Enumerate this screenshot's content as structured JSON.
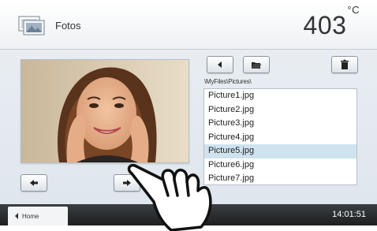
{
  "header": {
    "title": "Fotos",
    "temperature": "403",
    "unit": "°C"
  },
  "viewer": {
    "photo_alt": "Portrait photo"
  },
  "filebrowser": {
    "path": "\\MyFiles\\Pictures\\",
    "files": [
      "Picture1.jpg",
      "Picture2.jpg",
      "Picture3.jpg",
      "Picture4.jpg",
      "Picture5.jpg",
      "Picture6.jpg",
      "Picture7.jpg"
    ],
    "selected_index": 4
  },
  "footer": {
    "home_label": "Home",
    "time": "14:01:51"
  },
  "colors": {
    "selected_row": "#cfe3ef",
    "footer": "#2b2e31"
  },
  "icons": {
    "app": "photos-icon",
    "back": "arrow-left-icon",
    "open": "folder-icon",
    "delete": "trash-icon",
    "prev": "arrow-left-icon",
    "next": "arrow-right-icon",
    "home": "chevron-left-icon"
  }
}
